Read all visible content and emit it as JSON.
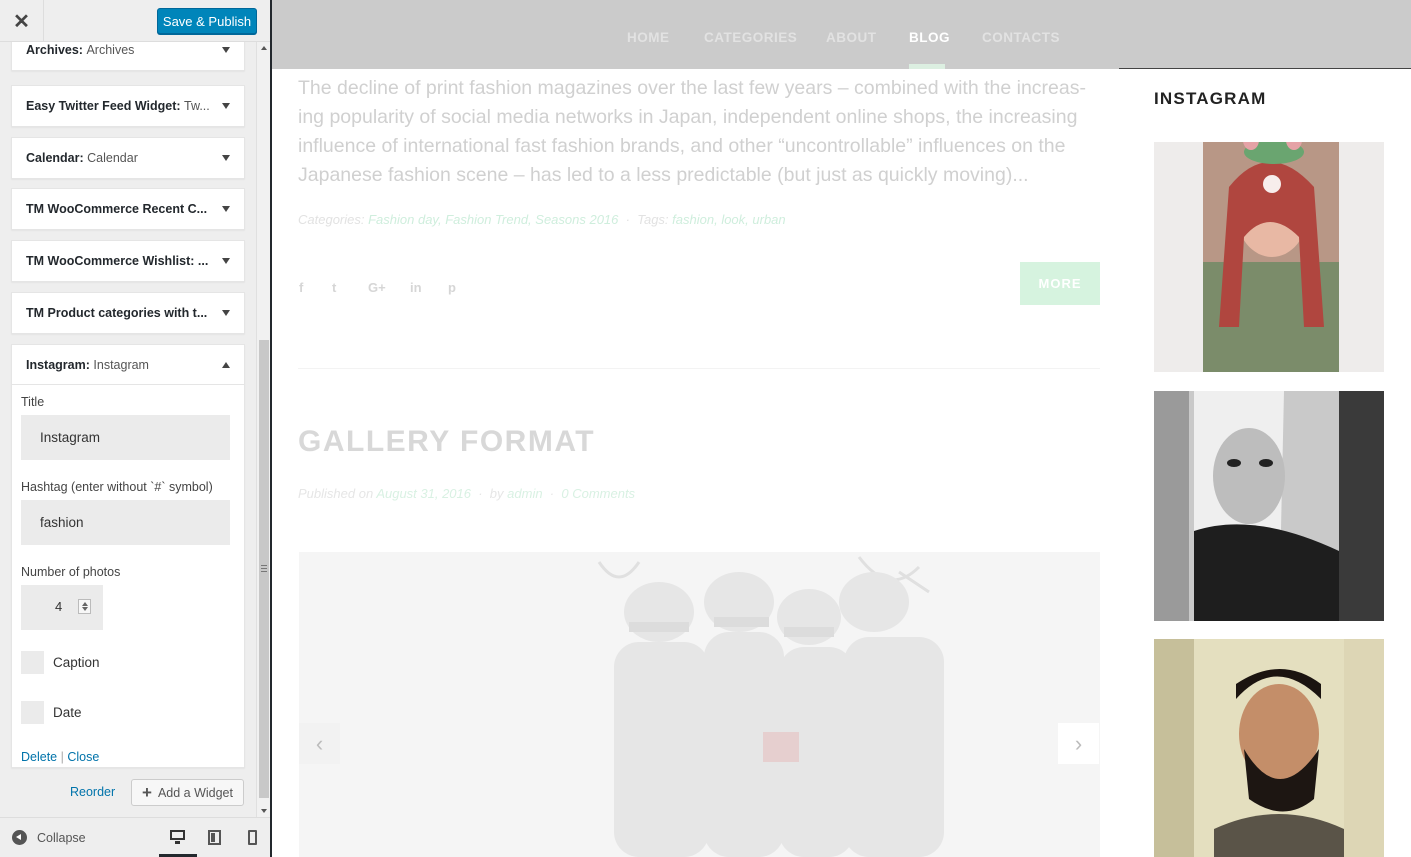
{
  "customizer": {
    "save_label": "Save & Publish",
    "widgets": [
      {
        "type": "Archives:",
        "title": "Archives"
      },
      {
        "type": "Easy Twitter Feed Widget:",
        "title": "Tw..."
      },
      {
        "type": "Calendar:",
        "title": "Calendar"
      },
      {
        "type": "TM WooCommerce Recent C...",
        "title": ""
      },
      {
        "type": "TM WooCommerce Wishlist: ...",
        "title": ""
      },
      {
        "type": "TM Product categories with t...",
        "title": ""
      }
    ],
    "open_widget": {
      "type": "Instagram:",
      "title": "Instagram",
      "fields": {
        "title_label": "Title",
        "title_value": "Instagram",
        "hashtag_label": "Hashtag (enter without `#` symbol)",
        "hashtag_value": "fashion",
        "photos_label": "Number of photos",
        "photos_value": "4",
        "caption_label": "Caption",
        "date_label": "Date"
      },
      "actions": {
        "delete": "Delete",
        "separator": "|",
        "close": "Close"
      }
    },
    "reorder_label": "Reorder",
    "add_widget_label": "Add a Widget",
    "collapse_label": "Collapse",
    "active_device": "desktop"
  },
  "preview": {
    "nav": [
      "HOME",
      "CATEGORIES",
      "ABOUT",
      "BLOG",
      "CONTACTS"
    ],
    "active_nav": "BLOG",
    "excerpt": "The decline of print fashion magazines over the last few years – combined with the increas-ing popularity of social media networks in Japan, independent online shops, the increasing influence of international fast fashion brands, and other “uncontrollable” influences on the Japanese fashion scene – has led to a less predictable (but just as quickly moving)...",
    "meta": {
      "categories_label": "Categories:",
      "categories": "Fashion day, Fashion Trend, Seasons 2016",
      "dot": "·",
      "tags_label": "Tags:",
      "tags": "fashion, look, urban"
    },
    "social_icons": [
      "f",
      "t",
      "G+",
      "in",
      "p"
    ],
    "more_label": "MORE",
    "post_title": "GALLERY FORMAT",
    "post_meta": {
      "published_label": "Published on",
      "date": "August 31, 2016",
      "by_label": "by",
      "author": "admin",
      "comments": "0 Comments"
    },
    "instagram_title": "INSTAGRAM"
  },
  "colors": {
    "primary_button": "#0085ba",
    "link": "#0073aa",
    "nav_bg": "#cbcbcb",
    "accent_mint": "#d6f3df"
  }
}
